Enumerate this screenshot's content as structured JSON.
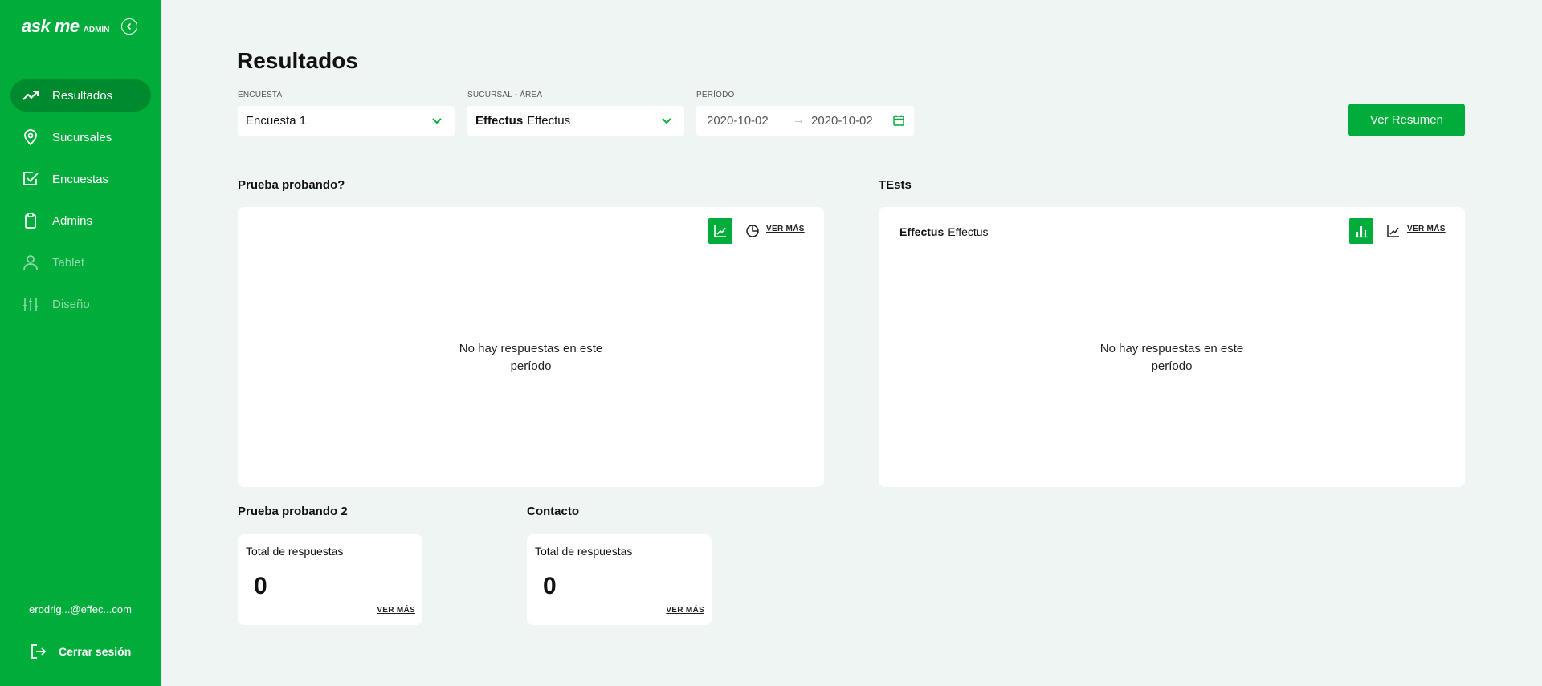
{
  "sidebar": {
    "logo": "ask me",
    "logo_sub": "ADMIN",
    "items": [
      {
        "label": "Resultados",
        "icon": "trending-up-icon",
        "active": true
      },
      {
        "label": "Sucursales",
        "icon": "map-pin-icon"
      },
      {
        "label": "Encuestas",
        "icon": "check-square-icon"
      },
      {
        "label": "Admins",
        "icon": "clipboard-icon"
      },
      {
        "label": "Tablet",
        "icon": "user-icon",
        "disabled": true
      },
      {
        "label": "Diseño",
        "icon": "sliders-icon",
        "disabled": true
      }
    ],
    "user_email": "erodrig...@effec...com",
    "logout_label": "Cerrar sesión"
  },
  "header": {
    "title": "Resultados"
  },
  "filters": {
    "survey_label": "ENCUESTA",
    "survey_value": "Encuesta 1",
    "branch_label": "SUCURSAL - ÁREA",
    "branch_bold": "Effectus",
    "branch_value": "Effectus",
    "period_label": "PERÍODO",
    "date_from": "2020-10-02",
    "date_arrow": "→",
    "date_to": "2020-10-02",
    "summary_button": "Ver Resumen"
  },
  "widgets": {
    "prueba": {
      "title": "Prueba probando?",
      "link": "VER MÁS",
      "empty_line1": "No hay respuestas en este",
      "empty_line2": "período"
    },
    "tests": {
      "title": "TEsts",
      "branch_bold": "Effectus",
      "branch_value": "Effectus",
      "link": "VER MÁS",
      "empty_line1": "No hay respuestas en este",
      "empty_line2": "período"
    },
    "prueba2": {
      "title": "Prueba probando 2",
      "label": "Total de respuestas",
      "value": "0",
      "link": "VER MÁS"
    },
    "contacto": {
      "title": "Contacto",
      "label": "Total de respuestas",
      "value": "0",
      "link": "VER MÁS"
    }
  },
  "colors": {
    "brand": "#00ac3a",
    "brand_dark": "#008a2e",
    "background": "#eff5f2"
  }
}
